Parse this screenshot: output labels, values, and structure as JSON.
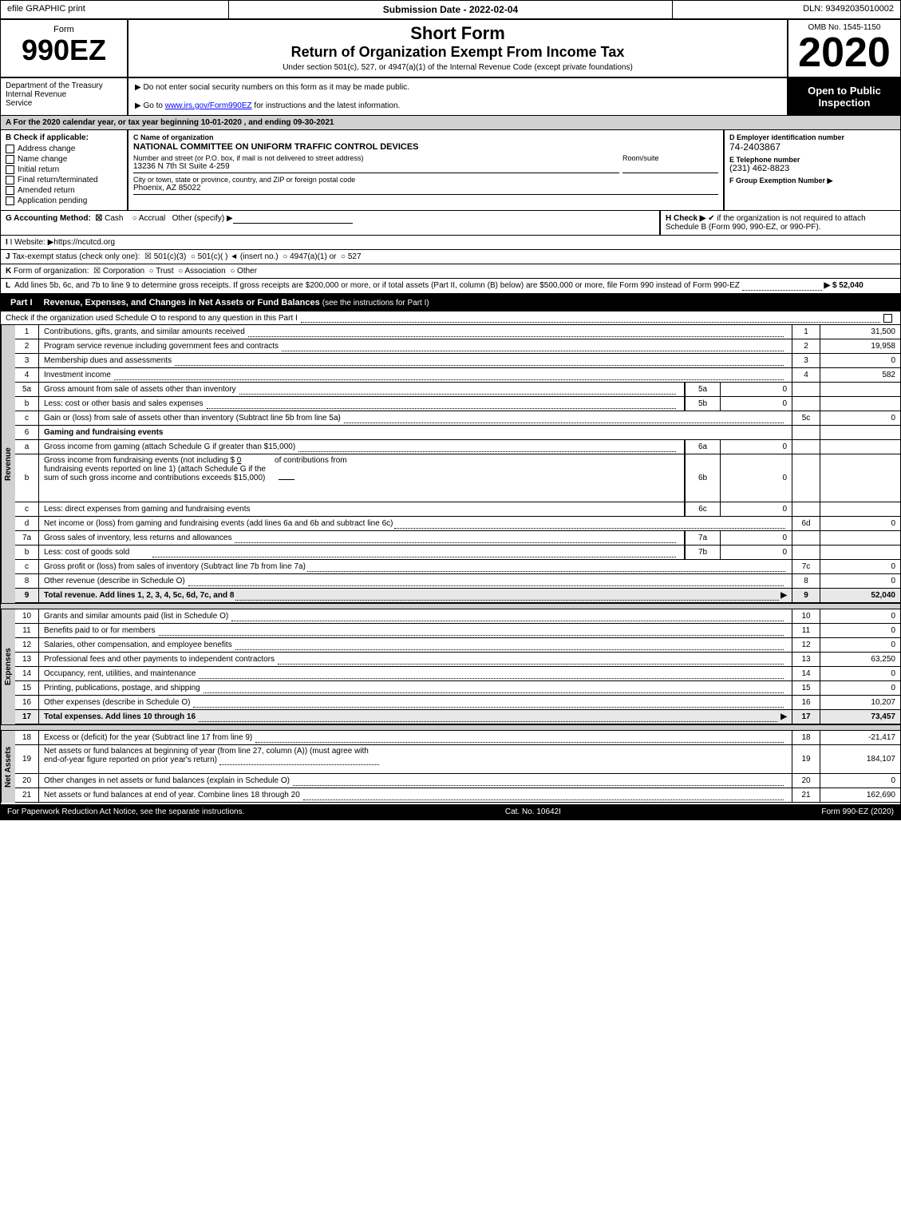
{
  "topBar": {
    "efile": "efile GRAPHIC print",
    "submissionLabel": "Submission Date - 2022-02-04",
    "dlnLabel": "DLN: 93492035010002"
  },
  "header": {
    "formNumber": "Form",
    "formCode": "990EZ",
    "formLabel": "",
    "shortFormTitle": "Short Form",
    "returnTitle": "Return of Organization Exempt From Income Tax",
    "underSection": "Under section 501(c), 527, or 4947(a)(1) of the Internal Revenue Code (except private foundations)",
    "year": "2020",
    "ombNumber": "OMB No. 1545-1150"
  },
  "instructions": {
    "doNotEnter": "▶ Do not enter social security numbers on this form as it may be made public.",
    "goTo": "▶ Go to",
    "websiteLink": "www.irs.gov/Form990EZ",
    "websiteSuffix": "for instructions and the latest information.",
    "openToPublic": "Open to Public Inspection"
  },
  "sectionA": {
    "text": "A For the 2020 calendar year, or tax year beginning 10-01-2020 , and ending 09-30-2021"
  },
  "checkB": {
    "label": "B Check if applicable:",
    "items": [
      {
        "label": "Address change",
        "checked": false
      },
      {
        "label": "Name change",
        "checked": false
      },
      {
        "label": "Initial return",
        "checked": false
      },
      {
        "label": "Final return/terminated",
        "checked": false
      },
      {
        "label": "Amended return",
        "checked": false
      },
      {
        "label": "Application pending",
        "checked": false
      }
    ]
  },
  "orgInfo": {
    "cLabel": "C Name of organization",
    "name": "NATIONAL COMMITTEE ON UNIFORM TRAFFIC CONTROL DEVICES",
    "addressLabel": "Number and street (or P.O. box, if mail is not delivered to street address)",
    "address": "13236 N 7th St Suite 4-259",
    "roomLabel": "Room/suite",
    "room": "",
    "cityLabel": "City or town, state or province, country, and ZIP or foreign postal code",
    "city": "Phoenix, AZ  85022"
  },
  "employerId": {
    "dLabel": "D Employer identification number",
    "ein": "74-2403867",
    "eLabel": "E Telephone number",
    "phone": "(231) 462-8823",
    "fLabel": "F Group Exemption Number ▶",
    "groupNum": ""
  },
  "accounting": {
    "gLabel": "G Accounting Method:",
    "cashLabel": "✔ Cash",
    "accrualLabel": "○ Accrual",
    "otherLabel": "Other (specify) ▶",
    "hLabel": "H Check ▶",
    "hCheckLabel": "✔ if the organization is not required to attach Schedule B (Form 990, 990-EZ, or 990-PF)."
  },
  "website": {
    "iLabel": "I Website: ▶https://ncutcd.org"
  },
  "taxStatus": {
    "jLabel": "J Tax-exempt status (check only one):",
    "options": [
      "✔ 501(c)(3)",
      "○ 501(c)( ) ◄ (insert no.)",
      "○ 4947(a)(1) or",
      "○ 527"
    ]
  },
  "formOrg": {
    "kLabel": "K Form of organization:",
    "options": [
      "✔ Corporation",
      "○ Trust",
      "○ Association",
      "○ Other"
    ]
  },
  "grossReceipts": {
    "lText": "L Add lines 5b, 6c, and 7b to line 9 to determine gross receipts. If gross receipts are $200,000 or more, or if total assets (Part II, column (B) below) are $500,000 or more, file Form 990 instead of Form 990-EZ",
    "amount": "▶ $ 52,040"
  },
  "partI": {
    "label": "Part I",
    "title": "Revenue, Expenses, and Changes in Net Assets or Fund Balances",
    "seeInstructions": "(see the instructions for Part I)",
    "checkScheduleO": "Check if the organization used Schedule O to respond to any question in this Part I",
    "rows": [
      {
        "num": "1",
        "description": "Contributions, gifts, grants, and similar amounts received",
        "lineNum": "1",
        "amount": "31,500"
      },
      {
        "num": "2",
        "description": "Program service revenue including government fees and contracts",
        "lineNum": "2",
        "amount": "19,958"
      },
      {
        "num": "3",
        "description": "Membership dues and assessments",
        "lineNum": "3",
        "amount": "0"
      },
      {
        "num": "4",
        "description": "Investment income",
        "lineNum": "4",
        "amount": "582"
      }
    ],
    "row5a": {
      "num": "5a",
      "description": "Gross amount from sale of assets other than inventory",
      "midLabel": "5a",
      "midAmount": "0"
    },
    "row5b": {
      "num": "b",
      "description": "Less: cost or other basis and sales expenses",
      "midLabel": "5b",
      "midAmount": "0"
    },
    "row5c": {
      "num": "c",
      "description": "Gain or (loss) from sale of assets other than inventory (Subtract line 5b from line 5a)",
      "lineNum": "5c",
      "amount": "0"
    },
    "row6": {
      "num": "6",
      "description": "Gaming and fundraising events"
    },
    "row6a": {
      "num": "a",
      "description": "Gross income from gaming (attach Schedule G if greater than $15,000)",
      "midLabel": "6a",
      "midAmount": "0"
    },
    "row6b": {
      "num": "b",
      "descLine1": "Gross income from fundraising events (not including $ 0",
      "descLine2": "of contributions from",
      "descLine3": "fundraising events reported on line 1) (attach Schedule G if the",
      "descLine4": "sum of such gross income and contributions exceeds $15,000)",
      "midLabel": "6b",
      "midAmount": "0"
    },
    "row6c": {
      "num": "c",
      "description": "Less: direct expenses from gaming and fundraising events",
      "midLabel": "6c",
      "midAmount": "0"
    },
    "row6d": {
      "num": "d",
      "description": "Net income or (loss) from gaming and fundraising events (add lines 6a and 6b and subtract line 6c)",
      "lineNum": "6d",
      "amount": "0"
    },
    "row7a": {
      "num": "7a",
      "description": "Gross sales of inventory, less returns and allowances",
      "midLabel": "7a",
      "midAmount": "0"
    },
    "row7b": {
      "num": "b",
      "description": "Less: cost of goods sold",
      "midLabel": "7b",
      "midAmount": "0"
    },
    "row7c": {
      "num": "c",
      "description": "Gross profit or (loss) from sales of inventory (Subtract line 7b from line 7a)",
      "lineNum": "7c",
      "amount": "0"
    },
    "row8": {
      "num": "8",
      "description": "Other revenue (describe in Schedule O)",
      "lineNum": "8",
      "amount": "0"
    },
    "row9": {
      "num": "9",
      "description": "Total revenue. Add lines 1, 2, 3, 4, 5c, 6d, 7c, and 8",
      "lineNum": "9",
      "amount": "52,040",
      "bold": true
    },
    "expenseRows": [
      {
        "num": "10",
        "description": "Grants and similar amounts paid (list in Schedule O)",
        "lineNum": "10",
        "amount": "0"
      },
      {
        "num": "11",
        "description": "Benefits paid to or for members",
        "lineNum": "11",
        "amount": "0"
      },
      {
        "num": "12",
        "description": "Salaries, other compensation, and employee benefits",
        "lineNum": "12",
        "amount": "0"
      },
      {
        "num": "13",
        "description": "Professional fees and other payments to independent contractors",
        "lineNum": "13",
        "amount": "63,250"
      },
      {
        "num": "14",
        "description": "Occupancy, rent, utilities, and maintenance",
        "lineNum": "14",
        "amount": "0"
      },
      {
        "num": "15",
        "description": "Printing, publications, postage, and shipping",
        "lineNum": "15",
        "amount": "0"
      },
      {
        "num": "16",
        "description": "Other expenses (describe in Schedule O)",
        "lineNum": "16",
        "amount": "10,207"
      }
    ],
    "row17": {
      "num": "17",
      "description": "Total expenses. Add lines 10 through 16",
      "lineNum": "17",
      "amount": "73,457",
      "bold": true
    },
    "netAssetRows": [
      {
        "num": "18",
        "description": "Excess or (deficit) for the year (Subtract line 17 from line 9)",
        "lineNum": "18",
        "amount": "-21,417"
      },
      {
        "num": "19",
        "description": "Net assets or fund balances at beginning of year (from line 27, column (A)) (must agree with end-of-year figure reported on prior year's return)",
        "lineNum": "19",
        "amount": "184,107"
      },
      {
        "num": "20",
        "description": "Other changes in net assets or fund balances (explain in Schedule O)",
        "lineNum": "20",
        "amount": "0"
      },
      {
        "num": "21",
        "description": "Net assets or fund balances at end of year. Combine lines 18 through 20",
        "lineNum": "21",
        "amount": "162,690"
      }
    ]
  },
  "footer": {
    "paperworkText": "For Paperwork Reduction Act Notice, see the separate instructions.",
    "catNo": "Cat. No. 10642I",
    "formRef": "Form 990-EZ (2020)"
  },
  "sideLabels": {
    "revenue": "Revenue",
    "expenses": "Expenses",
    "netAssets": "Net Assets"
  }
}
